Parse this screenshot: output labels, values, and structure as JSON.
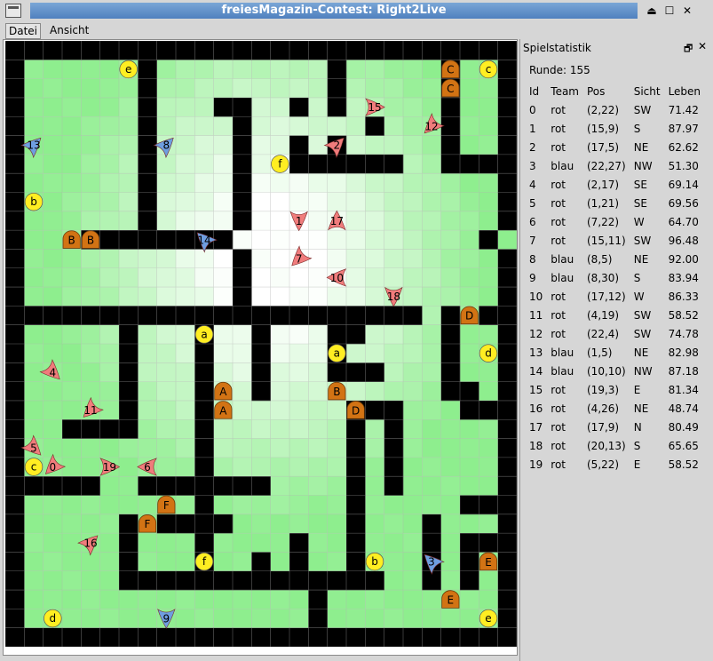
{
  "window": {
    "title": "freiesMagazin-Contest: Right2Live"
  },
  "menubar": {
    "items": [
      "Datei",
      "Ansicht"
    ]
  },
  "panel": {
    "title": "Spielstatistik",
    "round_text": "Runde: 155",
    "headers": [
      "Id",
      "Team",
      "Pos",
      "Sicht",
      "Leben"
    ],
    "rows": [
      [
        "0",
        "rot",
        "(2,22)",
        "SW",
        "71.42"
      ],
      [
        "1",
        "rot",
        "(15,9)",
        "S",
        "87.97"
      ],
      [
        "2",
        "rot",
        "(17,5)",
        "NE",
        "62.62"
      ],
      [
        "3",
        "blau",
        "(22,27)",
        "NW",
        "51.30"
      ],
      [
        "4",
        "rot",
        "(2,17)",
        "SE",
        "69.14"
      ],
      [
        "5",
        "rot",
        "(1,21)",
        "SE",
        "69.56"
      ],
      [
        "6",
        "rot",
        "(7,22)",
        "W",
        "64.70"
      ],
      [
        "7",
        "rot",
        "(15,11)",
        "SW",
        "96.48"
      ],
      [
        "8",
        "blau",
        "(8,5)",
        "NE",
        "92.00"
      ],
      [
        "9",
        "blau",
        "(8,30)",
        "S",
        "83.94"
      ],
      [
        "10",
        "rot",
        "(17,12)",
        "W",
        "86.33"
      ],
      [
        "11",
        "rot",
        "(4,19)",
        "SW",
        "58.52"
      ],
      [
        "12",
        "rot",
        "(22,4)",
        "SW",
        "74.78"
      ],
      [
        "13",
        "blau",
        "(1,5)",
        "NE",
        "82.98"
      ],
      [
        "14",
        "blau",
        "(10,10)",
        "NW",
        "87.18"
      ],
      [
        "15",
        "rot",
        "(19,3)",
        "E",
        "81.34"
      ],
      [
        "16",
        "rot",
        "(4,26)",
        "NE",
        "48.74"
      ],
      [
        "17",
        "rot",
        "(17,9)",
        "N",
        "80.49"
      ],
      [
        "18",
        "rot",
        "(20,13)",
        "S",
        "65.65"
      ],
      [
        "19",
        "rot",
        "(5,22)",
        "E",
        "58.52"
      ]
    ]
  },
  "colors": {
    "wall": "#000000",
    "grid_line": "#b0b0b0",
    "team_rot": "#f07c7c",
    "team_blau": "#6e9ee0",
    "teleporter": "#d27314",
    "key": "#ffee22",
    "title_bar": "#5a8ac6"
  },
  "board": {
    "columns": 27,
    "rows": 32,
    "walls": [
      "###########################",
      "#......#.........#.....#..#",
      "#......#.........#.....#..#",
      "#......#...##..#.#.....#..#",
      "#......#....#......#...#..#",
      "#......#....#..#.#.....#..#",
      "#......#....#..######..####",
      "#......#....#.............#",
      "#......#....#.............#",
      "#......#....#.............#",
      "#...########.............#",
      "#...........#.............#",
      "#...........#.............#",
      "#...........#.............#",
      "######################.#.##",
      "#.....#...#..#...##....#..#",
      "#.....#...#..#...#.....#..#",
      "#.....#...#..#...###...#..#",
      "#.....#...#..#.........##.#",
      "#.....#...#.......###...###",
      "#..####...#.......#.#.....#",
      "#.........#.......#.#.....#",
      "#.........#.......#.#.....#",
      "#####..#######....#.#.....#",
      "#.........#.......#.....###",
      "#.....#.####......#...#...#",
      "#.....#...#....#..#...#.###",
      "#.....#...#..#.#..#...#.#.#",
      "#.....##############..#.#.#",
      "#...............#.........#",
      "#...............#.........#",
      "###########################"
    ],
    "teleporters": [
      {
        "label": "C",
        "col": 23,
        "row": 1
      },
      {
        "label": "C",
        "col": 23,
        "row": 2
      },
      {
        "label": "B",
        "col": 3,
        "row": 10
      },
      {
        "label": "B",
        "col": 4,
        "row": 10
      },
      {
        "label": "D",
        "col": 24,
        "row": 14
      },
      {
        "label": "A",
        "col": 11,
        "row": 18
      },
      {
        "label": "A",
        "col": 11,
        "row": 19
      },
      {
        "label": "B",
        "col": 17,
        "row": 18
      },
      {
        "label": "D",
        "col": 18,
        "row": 19
      },
      {
        "label": "F",
        "col": 8,
        "row": 24
      },
      {
        "label": "F",
        "col": 7,
        "row": 25
      },
      {
        "label": "E",
        "col": 25,
        "row": 27
      },
      {
        "label": "E",
        "col": 23,
        "row": 29
      }
    ],
    "keys": [
      {
        "label": "e",
        "col": 6,
        "row": 1
      },
      {
        "label": "c",
        "col": 25,
        "row": 1
      },
      {
        "label": "f",
        "col": 14,
        "row": 6
      },
      {
        "label": "b",
        "col": 1,
        "row": 8
      },
      {
        "label": "a",
        "col": 10,
        "row": 15
      },
      {
        "label": "a",
        "col": 17,
        "row": 16
      },
      {
        "label": "d",
        "col": 25,
        "row": 16
      },
      {
        "label": "c",
        "col": 1,
        "row": 22
      },
      {
        "label": "f",
        "col": 10,
        "row": 27
      },
      {
        "label": "b",
        "col": 19,
        "row": 27
      },
      {
        "label": "d",
        "col": 2,
        "row": 30
      },
      {
        "label": "e",
        "col": 25,
        "row": 30
      }
    ],
    "players": [
      {
        "id": "0",
        "team": "rot",
        "col": 2,
        "row": 22
      },
      {
        "id": "1",
        "team": "rot",
        "col": 15,
        "row": 9
      },
      {
        "id": "2",
        "team": "rot",
        "col": 17,
        "row": 5
      },
      {
        "id": "3",
        "team": "blau",
        "col": 22,
        "row": 27
      },
      {
        "id": "4",
        "team": "rot",
        "col": 2,
        "row": 17
      },
      {
        "id": "5",
        "team": "rot",
        "col": 1,
        "row": 21
      },
      {
        "id": "6",
        "team": "rot",
        "col": 7,
        "row": 22
      },
      {
        "id": "7",
        "team": "rot",
        "col": 15,
        "row": 11
      },
      {
        "id": "8",
        "team": "blau",
        "col": 8,
        "row": 5
      },
      {
        "id": "9",
        "team": "blau",
        "col": 8,
        "row": 30
      },
      {
        "id": "10",
        "team": "rot",
        "col": 17,
        "row": 12
      },
      {
        "id": "11",
        "team": "rot",
        "col": 4,
        "row": 19
      },
      {
        "id": "12",
        "team": "rot",
        "col": 22,
        "row": 4
      },
      {
        "id": "13",
        "team": "blau",
        "col": 1,
        "row": 5
      },
      {
        "id": "14",
        "team": "blau",
        "col": 10,
        "row": 10
      },
      {
        "id": "15",
        "team": "rot",
        "col": 19,
        "row": 3
      },
      {
        "id": "16",
        "team": "rot",
        "col": 4,
        "row": 26
      },
      {
        "id": "17",
        "team": "rot",
        "col": 17,
        "row": 9
      },
      {
        "id": "18",
        "team": "rot",
        "col": 20,
        "row": 13
      },
      {
        "id": "19",
        "team": "rot",
        "col": 5,
        "row": 22
      }
    ]
  }
}
